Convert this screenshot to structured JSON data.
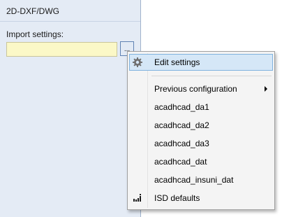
{
  "panel": {
    "title": "2D-DXF/DWG",
    "import_label": "Import settings:",
    "import_value": "",
    "ellipsis_label": "...",
    "background_color": "#e4ebf5",
    "input_color": "#fbf8c7"
  },
  "menu": {
    "highlight_color": "#d5e7f7",
    "items": [
      {
        "label": "Edit settings",
        "icon": "gear-icon",
        "highlighted": true
      },
      {
        "label": "Previous configuration",
        "has_submenu": true
      },
      {
        "label": "acadhcad_da1"
      },
      {
        "label": "acadhcad_da2"
      },
      {
        "label": "acadhcad_da3"
      },
      {
        "label": "acadhcad_dat"
      },
      {
        "label": "acadhcad_insuni_dat"
      },
      {
        "label": "ISD defaults",
        "icon": "isd-logo-icon"
      }
    ]
  }
}
